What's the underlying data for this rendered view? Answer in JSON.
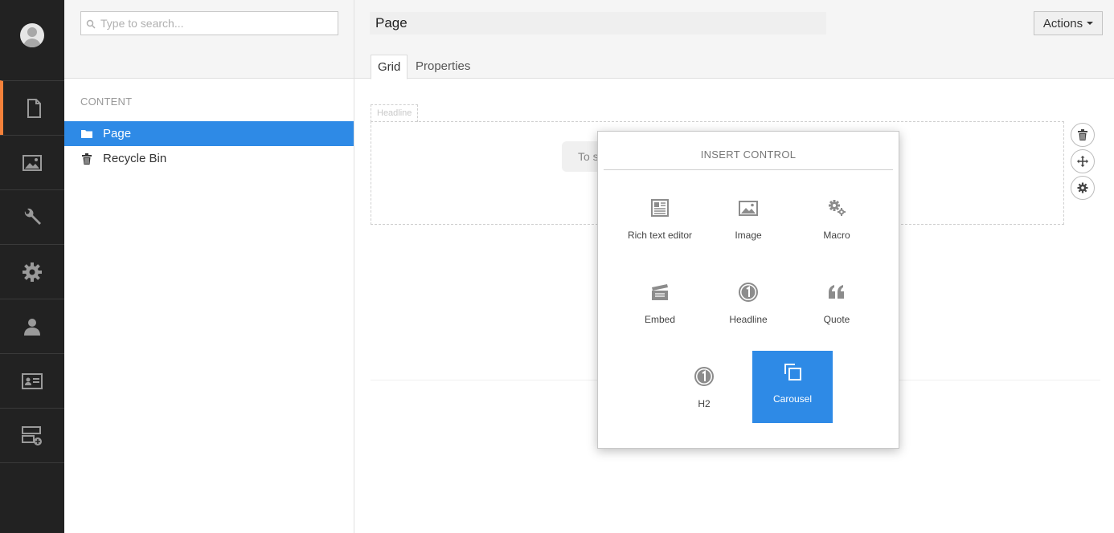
{
  "sections": {
    "items": [
      {
        "name": "content",
        "icon": "document-icon",
        "active": true
      },
      {
        "name": "media",
        "icon": "image-icon"
      },
      {
        "name": "developer",
        "icon": "wrench-icon"
      },
      {
        "name": "settings",
        "icon": "gear-icon"
      },
      {
        "name": "users",
        "icon": "user-icon"
      },
      {
        "name": "members",
        "icon": "id-card-icon"
      },
      {
        "name": "forms",
        "icon": "form-add-icon"
      }
    ],
    "accent_color": "#f5813a"
  },
  "tree": {
    "search": {
      "placeholder": "Type to search...",
      "value": ""
    },
    "section_label": "CONTENT",
    "nodes": [
      {
        "label": "Page",
        "icon": "folder-icon",
        "selected": true
      },
      {
        "label": "Recycle Bin",
        "icon": "trash-icon"
      }
    ],
    "selected_color": "#2e8ae6"
  },
  "editor": {
    "page_name": "Page",
    "actions_label": "Actions",
    "tabs": [
      {
        "label": "Grid",
        "active": true
      },
      {
        "label": "Properties"
      }
    ],
    "grid": {
      "headline_tag": "Headline",
      "placeholder_text": "To s"
    }
  },
  "insert_control": {
    "title": "INSERT CONTROL",
    "controls": [
      {
        "label": "Rich text editor",
        "icon": "rich-text-icon"
      },
      {
        "label": "Image",
        "icon": "image-icon"
      },
      {
        "label": "Macro",
        "icon": "cogs-icon"
      },
      {
        "label": "Embed",
        "icon": "clapperboard-icon"
      },
      {
        "label": "Headline",
        "icon": "numbered-circle-icon"
      },
      {
        "label": "Quote",
        "icon": "quote-icon"
      },
      {
        "label": "H2",
        "icon": "numbered-circle-icon"
      },
      {
        "label": "Carousel",
        "icon": "carousel-icon",
        "highlighted": true
      }
    ]
  }
}
